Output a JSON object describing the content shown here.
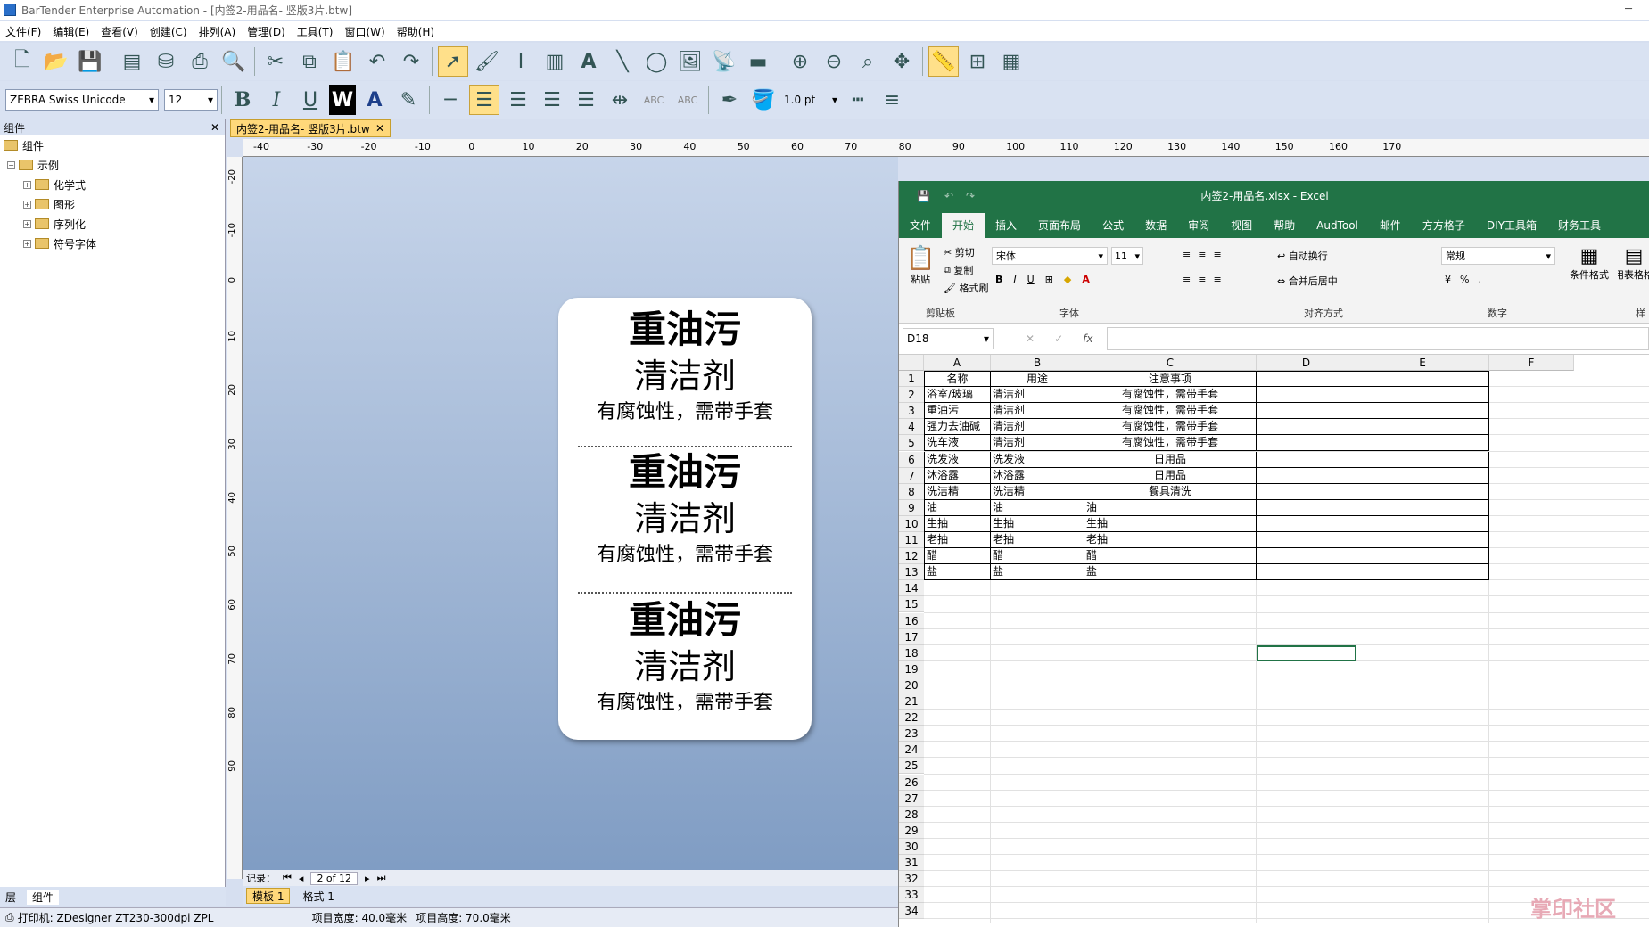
{
  "window": {
    "title": "BarTender Enterprise Automation - [内签2-用品名- 竖版3片.btw]"
  },
  "menu": [
    "文件(F)",
    "编辑(E)",
    "查看(V)",
    "创建(C)",
    "排列(A)",
    "管理(D)",
    "工具(T)",
    "窗口(W)",
    "帮助(H)"
  ],
  "toolbar2": {
    "font": "ZEBRA Swiss Unicode",
    "size": "12",
    "line_width": "1.0 pt"
  },
  "left_panel": {
    "header": "组件",
    "root": "组件",
    "example": "示例",
    "items": [
      "化学式",
      "图形",
      "序列化",
      "符号字体"
    ],
    "tabs": [
      "层",
      "组件"
    ]
  },
  "doc_tab": "内签2-用品名- 竖版3片.btw",
  "ruler_h": [
    "-40",
    "-30",
    "-20",
    "-10",
    "0",
    "10",
    "20",
    "30",
    "40",
    "50",
    "60",
    "70",
    "80",
    "90",
    "100",
    "110",
    "120",
    "130",
    "140",
    "150",
    "160",
    "170"
  ],
  "ruler_v": [
    "-20",
    "-10",
    "0",
    "10",
    "20",
    "30",
    "40",
    "50",
    "60",
    "70",
    "80",
    "90"
  ],
  "label": {
    "blocks": [
      {
        "name": "重油污",
        "type": "清洁剂",
        "note": "有腐蚀性，需带手套"
      },
      {
        "name": "重油污",
        "type": "清洁剂",
        "note": "有腐蚀性，需带手套"
      },
      {
        "name": "重油污",
        "type": "清洁剂",
        "note": "有腐蚀性，需带手套"
      }
    ]
  },
  "nav": {
    "record_label": "记录：",
    "record": "2 of 12"
  },
  "bottom_tabs": [
    "模板 1",
    "格式 1"
  ],
  "status": {
    "printer": "打印机: ZDesigner ZT230-300dpi ZPL",
    "width": "项目宽度: 40.0毫米",
    "height": "项目高度: 70.0毫米"
  },
  "excel": {
    "title": "内签2-用品名.xlsx  -  Excel",
    "tabs": [
      "文件",
      "开始",
      "插入",
      "页面布局",
      "公式",
      "数据",
      "审阅",
      "视图",
      "帮助",
      "AudTool",
      "邮件",
      "方方格子",
      "DIY工具箱",
      "财务工具"
    ],
    "ribbon": {
      "paste": "粘贴",
      "cut": "剪切",
      "copy": "复制",
      "painter": "格式刷",
      "clipboard": "剪贴板",
      "font_name": "宋体",
      "font_size": "11",
      "font_group": "字体",
      "wrap": "自动换行",
      "merge": "合并后居中",
      "align_group": "对齐方式",
      "number_format": "常规",
      "number_group": "数字",
      "cond_format": "条件格式",
      "table_format": "套用表格格式",
      "style_group": "样"
    },
    "name_box": "D18",
    "columns": [
      "A",
      "B",
      "C",
      "D",
      "E",
      "F"
    ],
    "rows": [
      [
        "名称",
        "用途",
        "注意事项"
      ],
      [
        "浴室/玻璃",
        "清洁剂",
        "有腐蚀性，需带手套"
      ],
      [
        "重油污",
        "清洁剂",
        "有腐蚀性，需带手套"
      ],
      [
        "强力去油碱",
        "清洁剂",
        "有腐蚀性，需带手套"
      ],
      [
        "洗车液",
        "清洁剂",
        "有腐蚀性，需带手套"
      ],
      [
        "洗发液",
        "洗发液",
        "日用品"
      ],
      [
        "沐浴露",
        "沐浴露",
        "日用品"
      ],
      [
        "洗洁精",
        "洗洁精",
        "餐具清洗"
      ],
      [
        "油",
        "油",
        "油"
      ],
      [
        "生抽",
        "生抽",
        "生抽"
      ],
      [
        "老抽",
        "老抽",
        "老抽"
      ],
      [
        "醋",
        "醋",
        "醋"
      ],
      [
        "盐",
        "盐",
        "盐"
      ]
    ],
    "row_numbers": [
      "1",
      "2",
      "3",
      "4",
      "5",
      "6",
      "7",
      "8",
      "9",
      "10",
      "11",
      "12",
      "13",
      "14",
      "15",
      "16",
      "17",
      "18",
      "19",
      "20",
      "21",
      "22",
      "23",
      "24",
      "25",
      "26",
      "27",
      "28",
      "29",
      "30",
      "31",
      "32",
      "33",
      "34"
    ]
  },
  "watermark": "掌印社区"
}
